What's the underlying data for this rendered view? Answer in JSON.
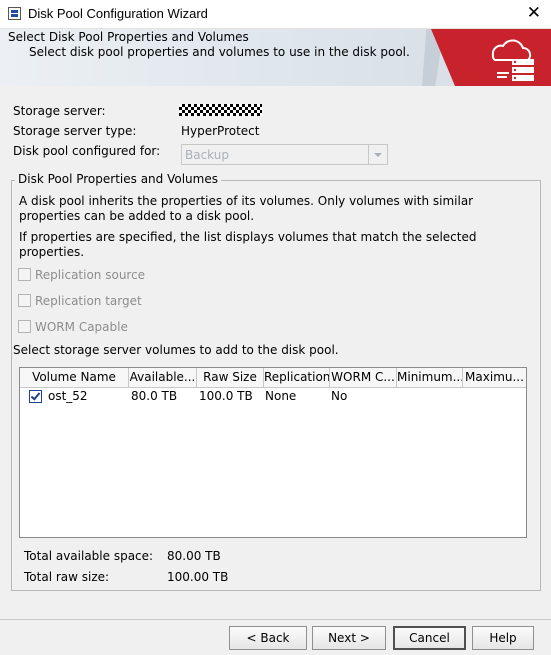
{
  "window": {
    "title": "Disk Pool Configuration Wizard",
    "close_glyph": "✕"
  },
  "banner": {
    "heading": "Select Disk Pool Properties and Volumes",
    "subheading": "Select disk pool properties and volumes to use in the disk pool."
  },
  "server": {
    "storage_server_label": "Storage server:",
    "storage_server_type_label": "Storage server type:",
    "storage_server_type_value": "HyperProtect",
    "configured_for_label": "Disk pool configured for:",
    "configured_for_value": "Backup"
  },
  "group": {
    "title": "Disk Pool Properties and Volumes",
    "desc1": "A disk pool inherits the properties of its volumes. Only volumes with similar properties can be added to a disk pool.",
    "desc2": "If properties are specified, the list displays volumes that match the selected properties.",
    "checkboxes": [
      {
        "label": "Replication source",
        "checked": false
      },
      {
        "label": "Replication target",
        "checked": false
      },
      {
        "label": "WORM Capable",
        "checked": false
      }
    ],
    "volumes_prompt": "Select storage server volumes to add to the disk pool."
  },
  "table": {
    "columns": [
      "Volume Name",
      "Available...",
      "Raw Size",
      "Replication",
      "WORM C...",
      "Minimum...",
      "Maximu..."
    ],
    "rows": [
      {
        "checked": true,
        "volume_name": "ost_52",
        "available": "80.0 TB",
        "raw_size": "100.0 TB",
        "replication": "None",
        "worm": "No",
        "minimum": "",
        "maximum": ""
      }
    ]
  },
  "totals": {
    "available_label": "Total available space:",
    "available_value": "80.00 TB",
    "raw_label": "Total raw size:",
    "raw_value": "100.00 TB"
  },
  "buttons": {
    "back": "< Back",
    "next": "Next >",
    "cancel": "Cancel",
    "help": "Help"
  },
  "colors": {
    "brand_red": "#c8232c",
    "check_blue": "#1f3f96"
  }
}
